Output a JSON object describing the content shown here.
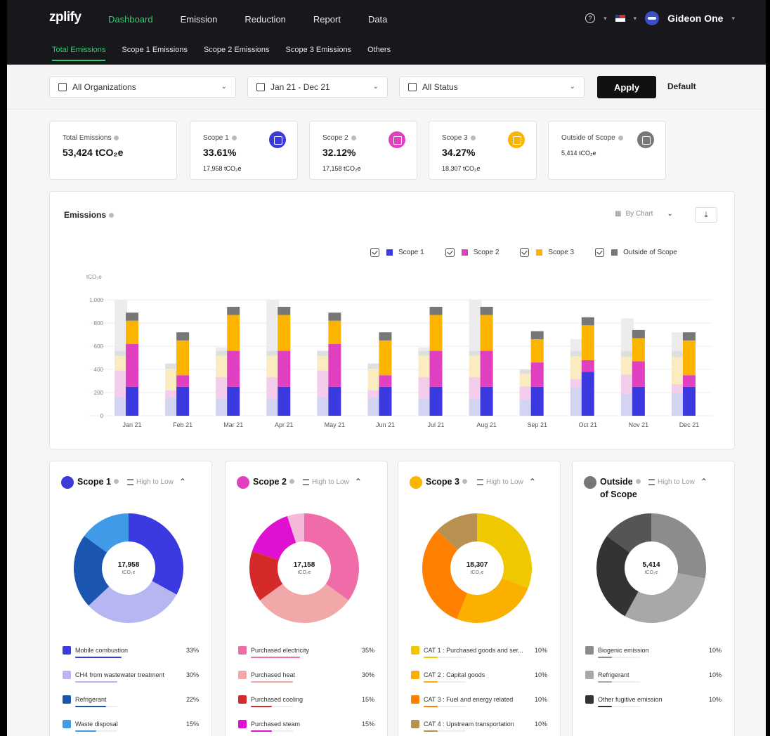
{
  "app": {
    "logo": "zplify",
    "nav": [
      "Dashboard",
      "Emission",
      "Reduction",
      "Report",
      "Data"
    ],
    "subnav": [
      "Total Emissions",
      "Scope 1 Emissions",
      "Scope 2 Emissions",
      "Scope 3 Emissions",
      "Others"
    ],
    "user": "Gideon One"
  },
  "filters": {
    "organization": "All Organizations",
    "date_range": "Jan 21 - Dec 21",
    "status": "All Status",
    "apply": "Apply",
    "default": "Default"
  },
  "kpis": {
    "total": {
      "label": "Total Emissions",
      "value": "53,424 tCO₂e"
    },
    "scope1": {
      "label": "Scope 1",
      "value": "33.61%",
      "sub": "17,958 tCO₂e",
      "color": "#3b3bd8"
    },
    "scope2": {
      "label": "Scope 2",
      "value": "32.12%",
      "sub": "17,158 tCO₂e",
      "color": "#e040c0"
    },
    "scope3": {
      "label": "Scope 3",
      "value": "34.27%",
      "sub": "18,307 tCO₂e",
      "color": "#f8b500"
    },
    "outside": {
      "label": "Outside of Scope",
      "sub": "5,414 tCO₂e",
      "color": "#777777"
    }
  },
  "emissions_panel": {
    "title": "Emissions",
    "view": "By Chart",
    "legend": [
      "Scope 1",
      "Scope 2",
      "Scope 3",
      "Outside of Scope"
    ]
  },
  "chart_data": {
    "type": "bar",
    "stacked": true,
    "title": "Emissions",
    "ylabel": "tCO₂e",
    "ylim": [
      0,
      1000
    ],
    "yticks": [
      "0",
      "200",
      "400",
      "600",
      "800",
      "1,000"
    ],
    "categories": [
      "Jan 21",
      "Feb 21",
      "Mar 21",
      "Apr 21",
      "May 21",
      "Jun 21",
      "Jul 21",
      "Aug 21",
      "Sep 21",
      "Oct 21",
      "Nov 21",
      "Dec 21"
    ],
    "series": [
      {
        "name": "Scope 1",
        "color": "#3a3ae0",
        "values": [
          250,
          250,
          250,
          250,
          250,
          250,
          250,
          250,
          250,
          380,
          250,
          250
        ]
      },
      {
        "name": "Scope 2",
        "color": "#e040c0",
        "values": [
          370,
          100,
          310,
          310,
          370,
          100,
          310,
          310,
          210,
          100,
          220,
          100
        ]
      },
      {
        "name": "Scope 3",
        "color": "#fbb400",
        "values": [
          200,
          300,
          310,
          310,
          200,
          300,
          310,
          310,
          200,
          300,
          200,
          300
        ]
      },
      {
        "name": "Outside of Scope",
        "color": "#777777",
        "values": [
          70,
          70,
          70,
          70,
          70,
          70,
          70,
          70,
          70,
          70,
          70,
          70
        ]
      }
    ],
    "ghost_totals": [
      1000,
      450,
      590,
      1000,
      560,
      450,
      590,
      1000,
      400,
      660,
      840,
      720
    ],
    "grid": true,
    "legend_position": "top-right"
  },
  "breakdowns": [
    {
      "title": "Scope 1",
      "title2": "",
      "sort": "High to Low",
      "icon_color": "#3b3bd8",
      "total": "17,958",
      "unit": "tCO₂e",
      "slices": [
        {
          "name": "Mobile combustion",
          "pct": "33%",
          "value": 33,
          "color": "#3a3ae0"
        },
        {
          "name": "CH4 from wastewater treatment",
          "pct": "30%",
          "value": 30,
          "color": "#b7b5f2"
        },
        {
          "name": "Refrigerant",
          "pct": "22%",
          "value": 22,
          "color": "#1a56b0"
        },
        {
          "name": "Waste disposal",
          "pct": "15%",
          "value": 15,
          "color": "#3f9be8"
        }
      ]
    },
    {
      "title": "Scope 2",
      "title2": "",
      "sort": "High to Low",
      "icon_color": "#e040c0",
      "total": "17,158",
      "unit": "tCO₂e",
      "slices": [
        {
          "name": "Purchased electricity",
          "pct": "35%",
          "value": 35,
          "color": "#f06ca8"
        },
        {
          "name": "Purchased heat",
          "pct": "30%",
          "value": 30,
          "color": "#f2a8a8"
        },
        {
          "name": "Purchased cooling",
          "pct": "15%",
          "value": 15,
          "color": "#d42a2a"
        },
        {
          "name": "Purchased steam",
          "pct": "15%",
          "value": 15,
          "color": "#e010d0"
        }
      ],
      "extra_slices": [
        {
          "value": 5,
          "color": "#f4b8d8"
        }
      ]
    },
    {
      "title": "Scope 3",
      "title2": "",
      "sort": "High to Low",
      "icon_color": "#f8b500",
      "total": "18,307",
      "unit": "tCO₂e",
      "slices": [
        {
          "name": "CAT 1 : Purchased goods and ser...",
          "pct": "10%",
          "value": 31,
          "color": "#f0c800"
        },
        {
          "name": "CAT 2 : Capital goods",
          "pct": "10%",
          "value": 25,
          "color": "#fbb000"
        },
        {
          "name": "CAT 3 : Fuel and energy related",
          "pct": "10%",
          "value": 31,
          "color": "#ff7f00"
        },
        {
          "name": "CAT 4 : Upstream transportation",
          "pct": "10%",
          "value": 13,
          "color": "#b89050"
        }
      ]
    },
    {
      "title": "Outside",
      "title2": "of Scope",
      "sort": "High to Low",
      "icon_color": "#777777",
      "total": "5,414",
      "unit": "tCO₂e",
      "slices": [
        {
          "name": "Biogenic emission",
          "pct": "10%",
          "value": 28,
          "color": "#8c8c8c"
        },
        {
          "name": "Refrigerant",
          "pct": "10%",
          "value": 30,
          "color": "#a8a8a8"
        },
        {
          "name": "Other fugitive emission",
          "pct": "10%",
          "value": 27,
          "color": "#333333"
        }
      ],
      "extra_slices": [
        {
          "value": 15,
          "color": "#555555"
        }
      ]
    }
  ]
}
